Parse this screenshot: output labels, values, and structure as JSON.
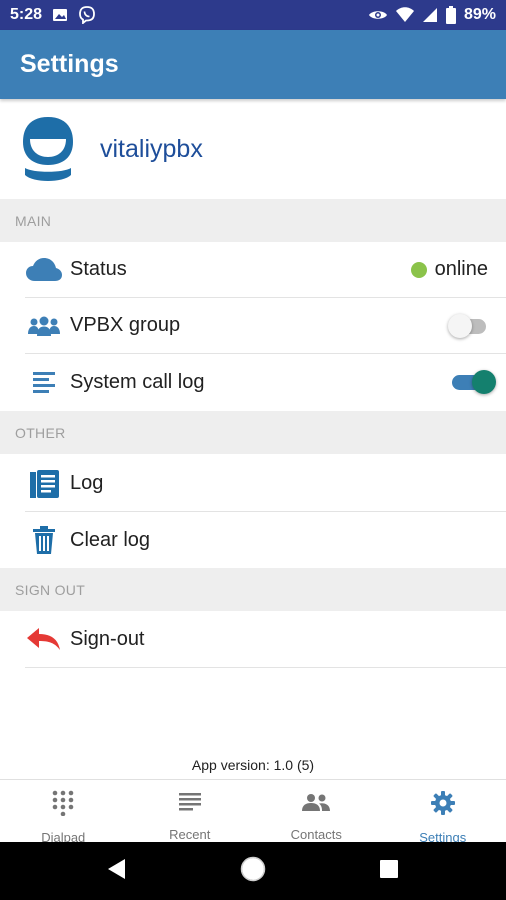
{
  "status_bar": {
    "time": "5:28",
    "battery": "89%",
    "left_icons": [
      "image-icon",
      "viber-icon"
    ],
    "right_icons": [
      "eye-icon",
      "wifi-icon",
      "signal-icon",
      "battery-icon"
    ]
  },
  "app_bar": {
    "title": "Settings"
  },
  "profile": {
    "username": "vitaliypbx",
    "avatar_icon": "user-avatar-icon"
  },
  "sections": {
    "main": {
      "header": "MAIN",
      "status": {
        "label": "Status",
        "value": "online",
        "icon": "cloud-icon",
        "dot_color": "#8bc34a"
      },
      "vpbx_group": {
        "label": "VPBX group",
        "icon": "group-icon",
        "enabled": false
      },
      "system_call_log": {
        "label": "System call log",
        "icon": "list-icon",
        "enabled": true
      }
    },
    "other": {
      "header": "OTHER",
      "log": {
        "label": "Log",
        "icon": "log-book-icon"
      },
      "clear_log": {
        "label": "Clear log",
        "icon": "trash-icon"
      }
    },
    "sign_out": {
      "header": "SIGN OUT",
      "sign_out": {
        "label": "Sign-out",
        "icon": "reply-arrow-icon"
      }
    }
  },
  "app_version": "App version: 1.0 (5)",
  "bottom_nav": [
    {
      "label": "Dialpad",
      "icon": "dialpad-icon",
      "active": false
    },
    {
      "label": "Recent",
      "icon": "recent-list-icon",
      "active": false
    },
    {
      "label": "Contacts",
      "icon": "contacts-icon",
      "active": false
    },
    {
      "label": "Settings",
      "icon": "gear-icon",
      "active": true
    }
  ],
  "colors": {
    "status_bar": "#2d3a8c",
    "app_bar": "#3d7fb6",
    "accent": "#3d7fb6",
    "toggle_on_thumb": "#14806e",
    "sign_out_icon": "#e53935",
    "username": "#1e4e9a"
  }
}
